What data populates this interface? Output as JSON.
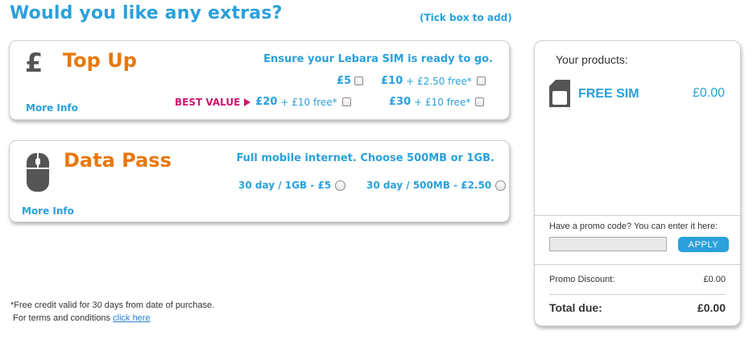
{
  "header": {
    "title": "Would you like any extras?",
    "tick_hint": "(Tick box to add)"
  },
  "topup": {
    "icon": "pound-icon",
    "symbol": "£",
    "title": "Top Up",
    "tagline": "Ensure your Lebara SIM is ready to go.",
    "more_info": "More Info",
    "best_value_label": "BEST VALUE",
    "options": [
      {
        "amount": "£5",
        "bonus": ""
      },
      {
        "amount": "£10",
        "bonus": "+ £2.50 free*"
      },
      {
        "amount": "£20",
        "bonus": "+ £10 free*"
      },
      {
        "amount": "£30",
        "bonus": "+ £10 free*"
      }
    ]
  },
  "datapass": {
    "icon": "mouse-icon",
    "title": "Data Pass",
    "tagline": "Full mobile internet. Choose 500MB or 1GB.",
    "more_info": "More Info",
    "options": [
      {
        "label": "30 day / 1GB - £5"
      },
      {
        "label": "30 day / 500MB - £2.50"
      }
    ]
  },
  "footnote": {
    "line1": "*Free credit valid for 30 days from date of purchase.",
    "line2": "For terms and conditions",
    "link": "click here"
  },
  "cart": {
    "heading": "Your products:",
    "items": [
      {
        "icon": "sim-card-icon",
        "name": "FREE SIM",
        "price": "£0.00"
      }
    ],
    "promo_label": "Have a promo code? You can enter it here:",
    "promo_value": "",
    "apply_label": "APPLY",
    "promo_discount_label": "Promo Discount:",
    "promo_discount_value": "£0.00",
    "total_label": "Total due:",
    "total_value": "£0.00"
  },
  "colors": {
    "accent_blue": "#2aa0dc",
    "title_orange": "#e8780c",
    "best_value_pink": "#d0166e"
  }
}
